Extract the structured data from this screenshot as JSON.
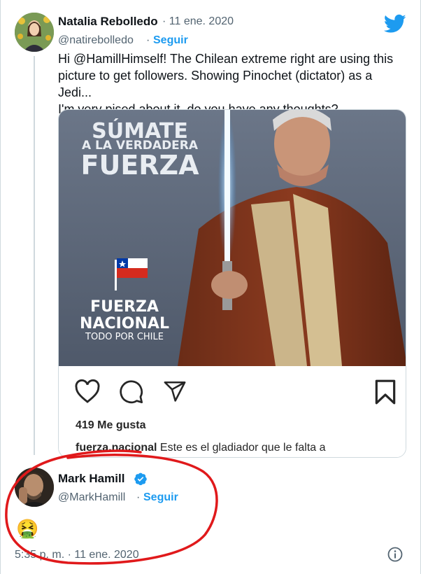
{
  "tweet1": {
    "author_name": "Natalia Rebolledo",
    "date": "· 11 ene. 2020",
    "handle": "@natirebolledo",
    "separator": "·",
    "follow_label": "Seguir",
    "text_lines": [
      "Hi @HamillHimself! The Chilean extreme right are using this",
      "picture to get followers. Showing Pinochet (dictator) as a Jedi...",
      "I'm very pised about it, do you have any thoughts?"
    ]
  },
  "embed": {
    "poster_headline_1": "SÚMATE",
    "poster_headline_2": "A LA VERDADERA",
    "poster_headline_3": "FUERZA",
    "logo_line_1": "FUERZA",
    "logo_line_2": "NACIONAL",
    "logo_tagline": "TODO POR CHILE",
    "likes": "419 Me gusta",
    "caption_user": "fuerza.nacional",
    "caption_text": " Este es el gladiador que le falta a"
  },
  "tweet2": {
    "author_name": "Mark Hamill",
    "handle": "@MarkHamill",
    "separator": "·",
    "follow_label": "Seguir",
    "emoji": "🤮",
    "timestamp": "5:35 p. m. · 11 ene. 2020"
  },
  "colors": {
    "brand_blue": "#1d9bf0",
    "annotation_red": "#e0191b"
  },
  "icons": [
    "twitter-bird-icon",
    "heart-icon",
    "comment-icon",
    "share-icon",
    "bookmark-icon",
    "verified-badge-icon",
    "info-icon"
  ]
}
